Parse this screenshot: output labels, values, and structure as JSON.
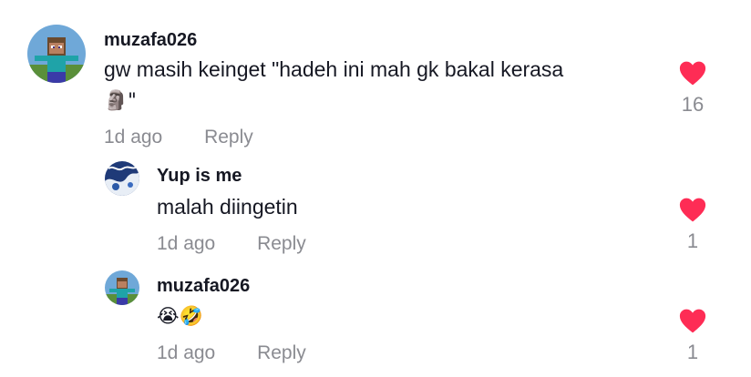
{
  "comments": [
    {
      "username": "muzafa026",
      "text": "gw masih keinget \"hadeh ini mah gk bakal kerasa",
      "text_line2": "🗿\"",
      "time": "1d ago",
      "reply": "Reply",
      "likes": "16",
      "avatar": "minecraft-steve-avatar"
    },
    {
      "username": "Yup is me",
      "text": "malah diingetin",
      "time": "1d ago",
      "reply": "Reply",
      "likes": "1",
      "avatar": "blue-white-abstract-avatar"
    },
    {
      "username": "muzafa026",
      "text": "😭🤣",
      "time": "1d ago",
      "reply": "Reply",
      "likes": "1",
      "avatar": "minecraft-steve-avatar"
    }
  ],
  "colors": {
    "heart": "#fe2c55",
    "meta": "#8a8b91",
    "text": "#161823"
  }
}
